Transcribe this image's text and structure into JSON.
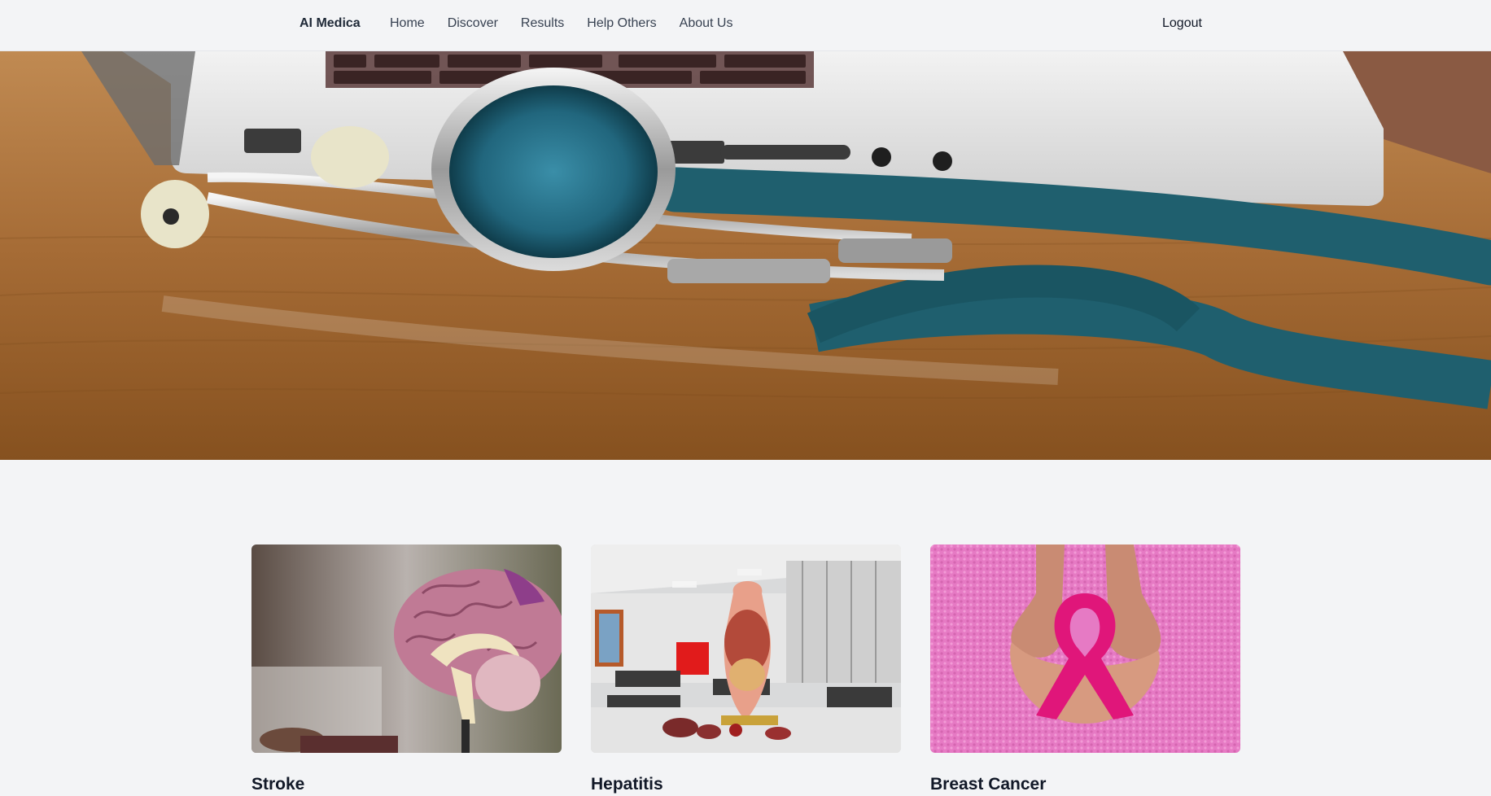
{
  "nav": {
    "brand": "AI Medica",
    "links": [
      "Home",
      "Discover",
      "Results",
      "Help Others",
      "About Us"
    ],
    "logout": "Logout"
  },
  "hero": {
    "image": "stethoscope-on-laptop-photo"
  },
  "cards": [
    {
      "title": "Stroke",
      "image": "brain-model-photo"
    },
    {
      "title": "Hepatitis",
      "image": "anatomy-torso-model-photo"
    },
    {
      "title": "Breast Cancer",
      "image": "pink-ribbon-hands-photo"
    }
  ],
  "colors": {
    "page_background": "#f3f4f6",
    "text": "#111827",
    "nav_text": "#374151"
  }
}
